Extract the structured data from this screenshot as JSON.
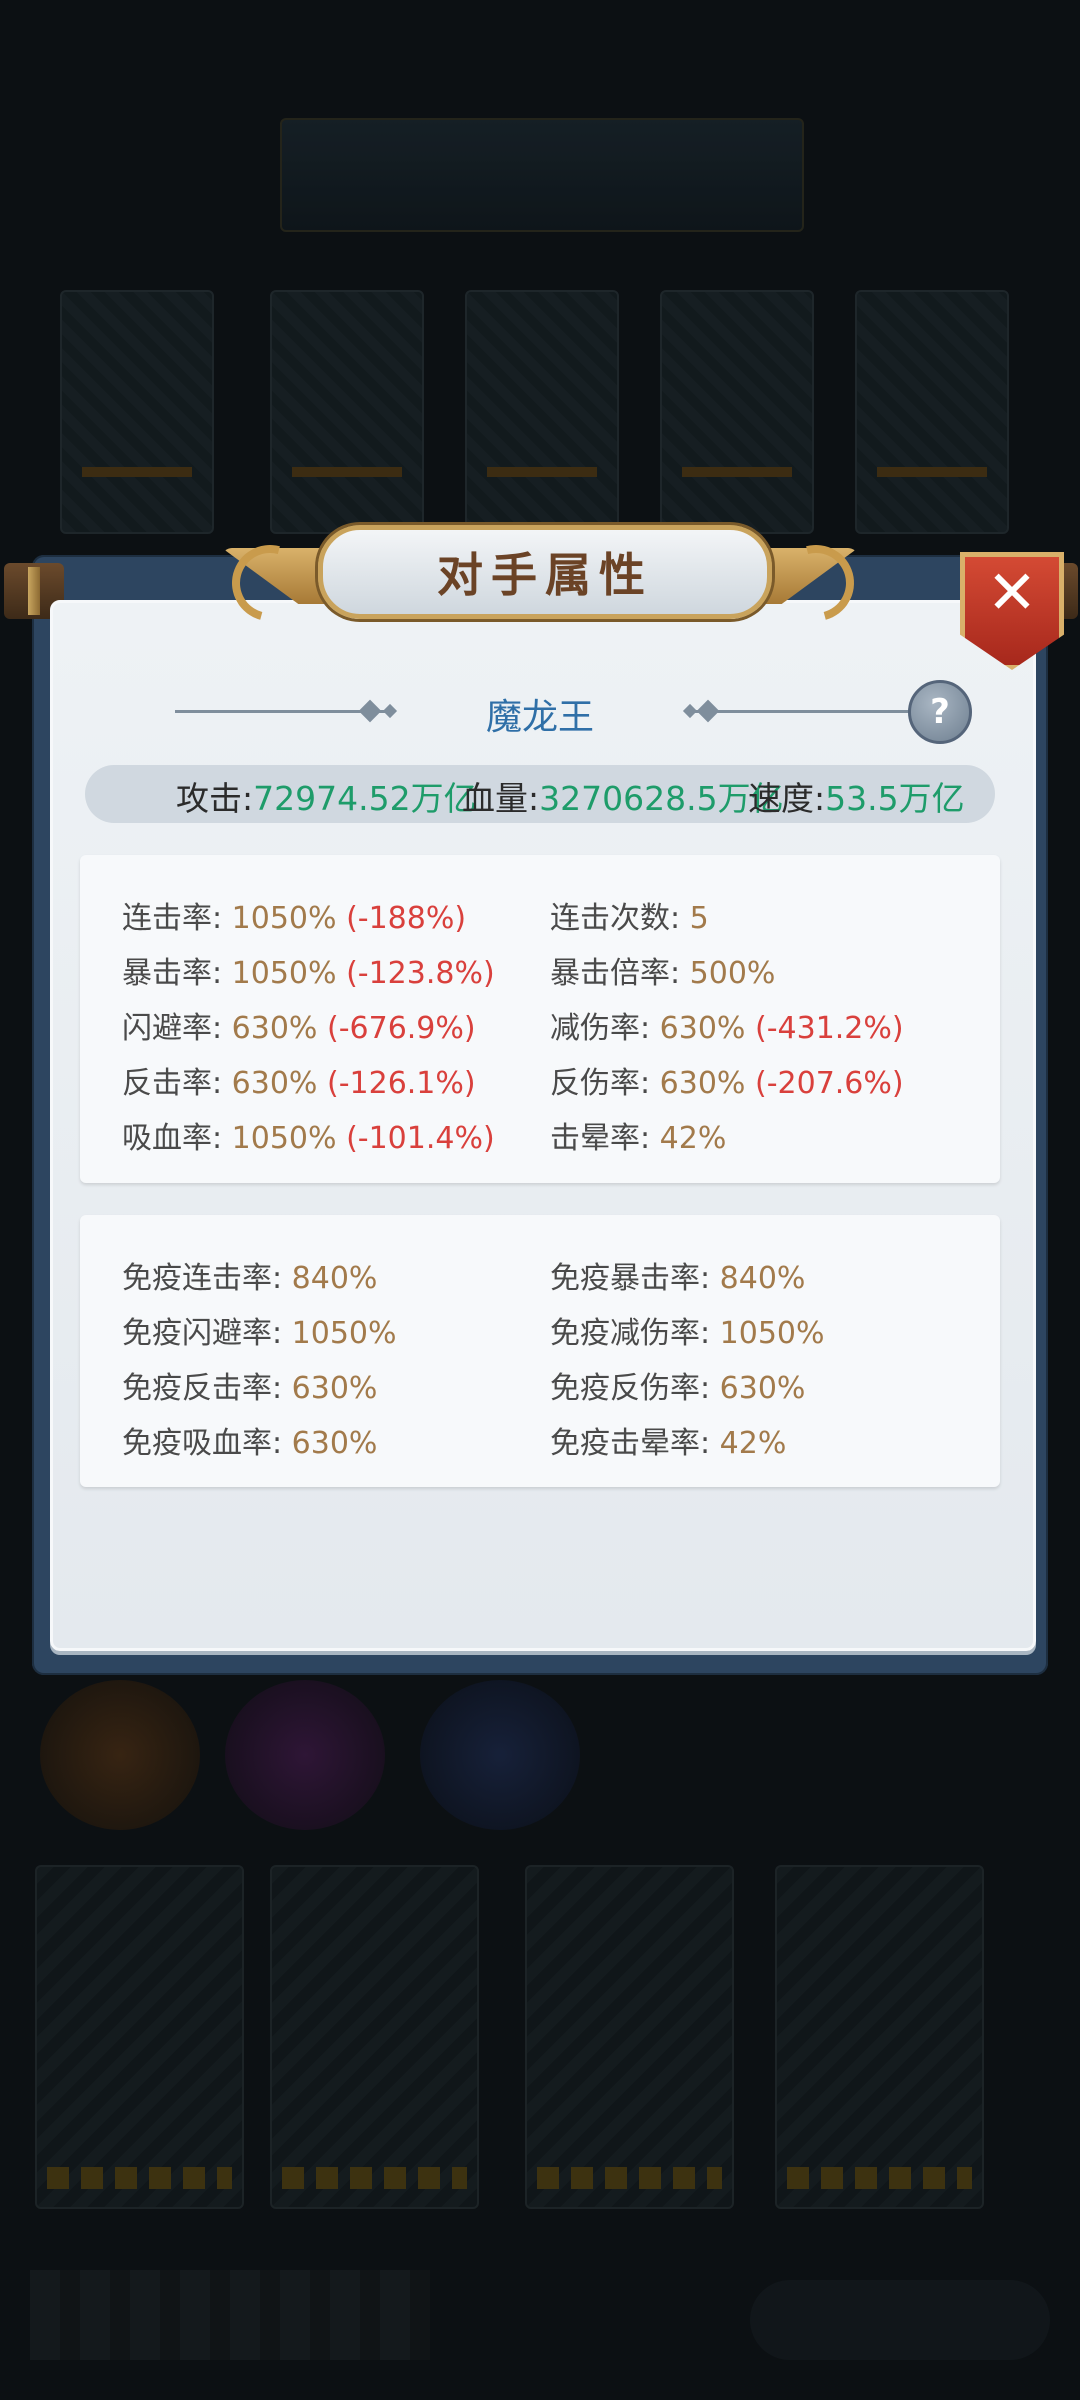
{
  "panel": {
    "title": "对手属性",
    "opponent_name": "魔龙王",
    "help_label": "?",
    "close_icon": "close-x-icon"
  },
  "summary": {
    "attack_label": "攻击:",
    "attack_value": "72974.52万亿",
    "hp_label": "血量:",
    "hp_value": "3270628.5万亿",
    "speed_label": "速度:",
    "speed_value": "53.5万亿"
  },
  "attributes": [
    {
      "label": "连击率:",
      "value": "1050%",
      "delta": "(-188%)"
    },
    {
      "label": "连击次数:",
      "value": "5",
      "delta": ""
    },
    {
      "label": "暴击率:",
      "value": "1050%",
      "delta": "(-123.8%)"
    },
    {
      "label": "暴击倍率:",
      "value": "500%",
      "delta": ""
    },
    {
      "label": "闪避率:",
      "value": "630%",
      "delta": "(-676.9%)"
    },
    {
      "label": "减伤率:",
      "value": "630%",
      "delta": "(-431.2%)"
    },
    {
      "label": "反击率:",
      "value": "630%",
      "delta": "(-126.1%)"
    },
    {
      "label": "反伤率:",
      "value": "630%",
      "delta": "(-207.6%)"
    },
    {
      "label": "吸血率:",
      "value": "1050%",
      "delta": "(-101.4%)"
    },
    {
      "label": "击晕率:",
      "value": "42%",
      "delta": ""
    }
  ],
  "immunities": [
    {
      "label": "免疫连击率:",
      "value": "840%"
    },
    {
      "label": "免疫暴击率:",
      "value": "840%"
    },
    {
      "label": "免疫闪避率:",
      "value": "1050%"
    },
    {
      "label": "免疫减伤率:",
      "value": "1050%"
    },
    {
      "label": "免疫反击率:",
      "value": "630%"
    },
    {
      "label": "免疫反伤率:",
      "value": "630%"
    },
    {
      "label": "免疫吸血率:",
      "value": "630%"
    },
    {
      "label": "免疫击晕率:",
      "value": "42%"
    }
  ],
  "colors": {
    "value_brown": "#a27a4b",
    "delta_red": "#d9403c",
    "summary_green": "#1e9c6a",
    "name_blue": "#2f6fa7"
  }
}
